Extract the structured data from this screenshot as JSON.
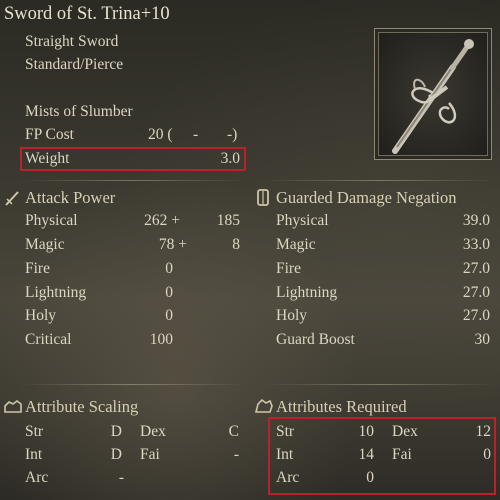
{
  "item": {
    "name": "Sword of St. Trina+10",
    "weapon_type": "Straight Sword",
    "damage_type": "Standard/Pierce",
    "skill": "Mists of Slumber",
    "fp_cost_label": "FP Cost",
    "fp_cost_value": "20 (",
    "fp_cost_dash1": "-",
    "fp_cost_dash2": "-)",
    "weight_label": "Weight",
    "weight_value": "3.0"
  },
  "attack_power": {
    "title": "Attack Power",
    "rows": [
      {
        "label": "Physical",
        "base": "262 +",
        "bonus": "185"
      },
      {
        "label": "Magic",
        "base": "78 +",
        "bonus": "8"
      },
      {
        "label": "Fire",
        "base": "0",
        "bonus": ""
      },
      {
        "label": "Lightning",
        "base": "0",
        "bonus": ""
      },
      {
        "label": "Holy",
        "base": "0",
        "bonus": ""
      },
      {
        "label": "Critical",
        "base": "100",
        "bonus": ""
      }
    ]
  },
  "guarded_damage_negation": {
    "title": "Guarded Damage Negation",
    "rows": [
      {
        "label": "Physical",
        "value": "39.0"
      },
      {
        "label": "Magic",
        "value": "33.0"
      },
      {
        "label": "Fire",
        "value": "27.0"
      },
      {
        "label": "Lightning",
        "value": "27.0"
      },
      {
        "label": "Holy",
        "value": "27.0"
      },
      {
        "label": "Guard Boost",
        "value": "30"
      }
    ]
  },
  "attribute_scaling": {
    "title": "Attribute Scaling",
    "str_label": "Str",
    "str_value": "D",
    "dex_label": "Dex",
    "dex_value": "C",
    "int_label": "Int",
    "int_value": "D",
    "fai_label": "Fai",
    "fai_value": "-",
    "arc_label": "Arc",
    "arc_value": "-"
  },
  "attributes_required": {
    "title": "Attributes Required",
    "str_label": "Str",
    "str_value": "10",
    "dex_label": "Dex",
    "dex_value": "12",
    "int_label": "Int",
    "int_value": "14",
    "fai_label": "Fai",
    "fai_value": "0",
    "arc_label": "Arc",
    "arc_value": "0"
  },
  "colors": {
    "highlight_box": "#b8222a",
    "text": "#ddd6c2"
  },
  "icons": {
    "attack_power": "sword-icon",
    "guarded_damage_negation": "shield-icon",
    "attribute_scaling": "scaling-hand-icon",
    "attributes_required": "requirement-hand-icon"
  }
}
